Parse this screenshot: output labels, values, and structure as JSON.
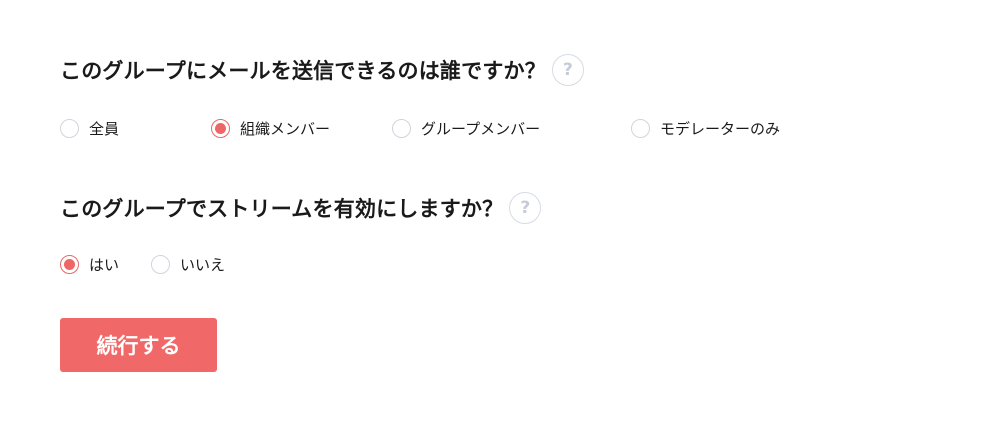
{
  "email_permission": {
    "question": "このグループにメールを送信できるのは誰ですか？",
    "help_label": "?",
    "options": [
      {
        "label": "全員",
        "checked": false
      },
      {
        "label": "組織メンバー",
        "checked": true
      },
      {
        "label": "グループメンバー",
        "checked": false
      },
      {
        "label": "モデレーターのみ",
        "checked": false
      }
    ]
  },
  "stream": {
    "question": "このグループでストリームを有効にしますか？",
    "help_label": "?",
    "options": [
      {
        "label": "はい",
        "checked": true
      },
      {
        "label": "いいえ",
        "checked": false
      }
    ]
  },
  "submit_label": "続行する",
  "colors": {
    "accent": "#f06868",
    "radio_border": "#cfd4dc",
    "help_icon": "#c5ccd8"
  }
}
